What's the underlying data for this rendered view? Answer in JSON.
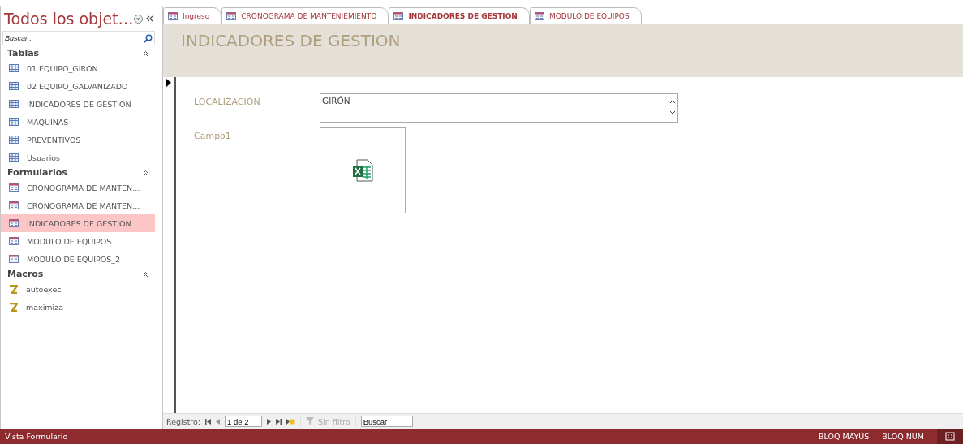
{
  "nav": {
    "title": "Todos los objet…",
    "search": {
      "placeholder": "Buscar..."
    },
    "groups": [
      {
        "title": "Tablas",
        "kind": "table",
        "items": [
          {
            "label": "01 EQUIPO_GIRON",
            "selected": false
          },
          {
            "label": "02 EQUIPO_GALVANIZADO",
            "selected": false
          },
          {
            "label": "INDICADORES DE GESTION",
            "selected": false
          },
          {
            "label": "MAQUINAS",
            "selected": false
          },
          {
            "label": "PREVENTIVOS",
            "selected": false
          },
          {
            "label": "Usuarios",
            "selected": false
          }
        ]
      },
      {
        "title": "Formularios",
        "kind": "form",
        "items": [
          {
            "label": "CRONOGRAMA DE MANTEN...",
            "selected": false
          },
          {
            "label": "CRONOGRAMA DE MANTEN...",
            "selected": false
          },
          {
            "label": "INDICADORES DE GESTION",
            "selected": true
          },
          {
            "label": "MODULO DE EQUIPOS",
            "selected": false
          },
          {
            "label": "MODULO DE EQUIPOS_2",
            "selected": false
          }
        ]
      },
      {
        "title": "Macros",
        "kind": "macro",
        "items": [
          {
            "label": "autoexec",
            "selected": false
          },
          {
            "label": "maximiza",
            "selected": false
          }
        ]
      }
    ]
  },
  "tabs": [
    {
      "label": "Ingreso",
      "selected": false
    },
    {
      "label": "CRONOGRAMA DE MANTENIEMIENTO",
      "selected": false
    },
    {
      "label": "INDICADORES DE GESTION",
      "selected": true
    },
    {
      "label": "MODULO DE EQUIPOS",
      "selected": false
    }
  ],
  "form": {
    "title": "INDICADORES DE GESTION",
    "fields": [
      {
        "label": "LOCALIZACIÓN",
        "kind": "text",
        "value": "GIRÓN"
      },
      {
        "label": "Campo1",
        "kind": "attachment"
      }
    ]
  },
  "record_nav": {
    "label": "Registro:",
    "position": "1 de 2",
    "filter": "Sin filtro",
    "search": "Buscar"
  },
  "status_bar": {
    "view": "Vista Formulario",
    "indicators": [
      "BLOQ MAYÚS",
      "BLOQ NUM"
    ]
  }
}
